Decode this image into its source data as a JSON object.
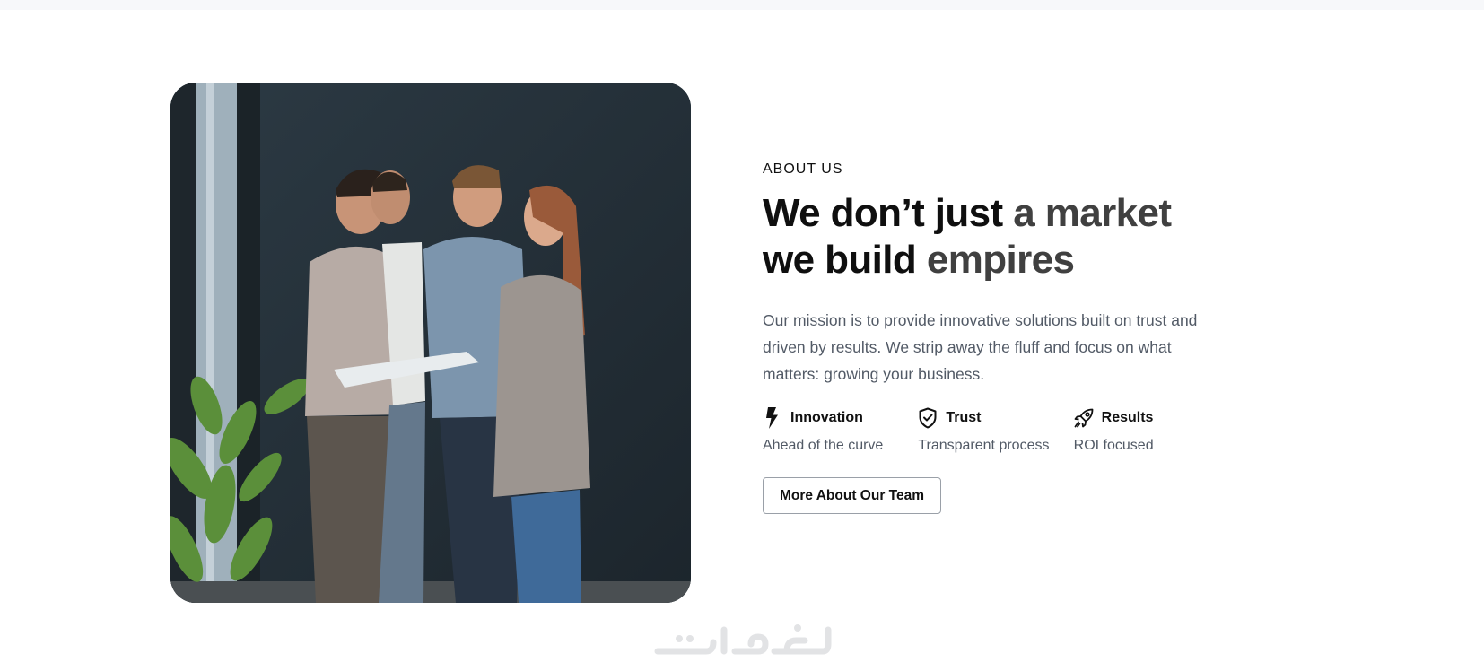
{
  "section": {
    "eyebrow": "ABOUT US",
    "headline_line1_dark": "We don’t just ",
    "headline_line1_mid": "a market",
    "headline_line2_dark": "we build ",
    "headline_line2_mid": "empires",
    "description": "Our mission is to provide innovative solutions built on trust and driven by results. We strip away the fluff and focus on what matters: growing your business."
  },
  "features": [
    {
      "icon": "lightning-bolt-icon",
      "title": "Innovation",
      "subtitle": "Ahead of the curve"
    },
    {
      "icon": "shield-check-icon",
      "title": "Trust",
      "subtitle": "Transparent process"
    },
    {
      "icon": "rocket-icon",
      "title": "Results",
      "subtitle": "ROI focused"
    }
  ],
  "cta": {
    "label": "More About Our Team"
  },
  "image": {
    "subject": "team-meeting-photo"
  },
  "colors": {
    "headline_dark": "#0f0f0f",
    "headline_mid": "#404040",
    "body_text": "#525a66",
    "button_border": "#9aa0a8",
    "photo_background": "#2a3640"
  }
}
